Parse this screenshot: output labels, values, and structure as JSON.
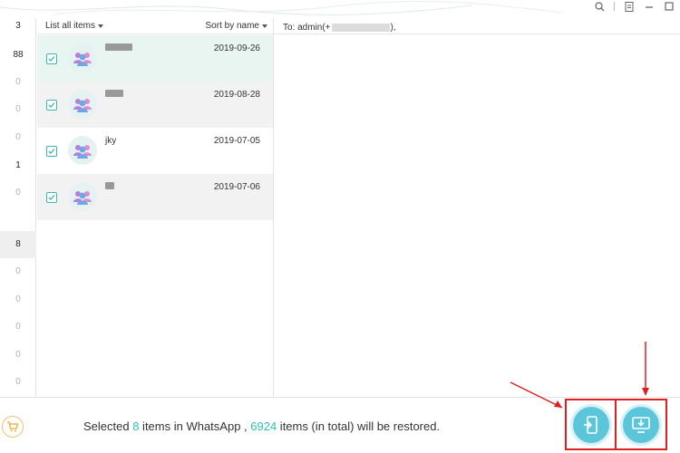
{
  "window": {
    "controls": [
      "search-icon",
      "menu-icon",
      "minimize-icon",
      "maximize-icon"
    ]
  },
  "counts": [
    "3",
    "88",
    "0",
    "0",
    "0",
    "1",
    "0",
    "",
    "8",
    "0",
    "0",
    "0",
    "0",
    "0"
  ],
  "list_header": {
    "list_all_label": "List all items",
    "sort_label": "Sort by name"
  },
  "recipient": {
    "prefix": "To: admin(+",
    "suffix": "),"
  },
  "chats": [
    {
      "name": "",
      "date": "2019-09-26",
      "checked": true
    },
    {
      "name": "",
      "date": "2019-08-28",
      "checked": true
    },
    {
      "name": "jky",
      "date": "2019-07-05",
      "checked": true
    },
    {
      "name": "",
      "date": "2019-07-06",
      "checked": true
    }
  ],
  "status": {
    "part1": "Selected ",
    "selected_count": "8",
    "part2": " items in WhatsApp , ",
    "total_count": "6924",
    "part3": " items (in total) will be restored."
  },
  "colors": {
    "accent": "#2bbfb3",
    "action_button": "#5bc6da",
    "annotation": "#e02020"
  },
  "actions": {
    "restore_to_device_icon": "phone-restore-icon",
    "download_to_computer_icon": "computer-download-icon"
  }
}
